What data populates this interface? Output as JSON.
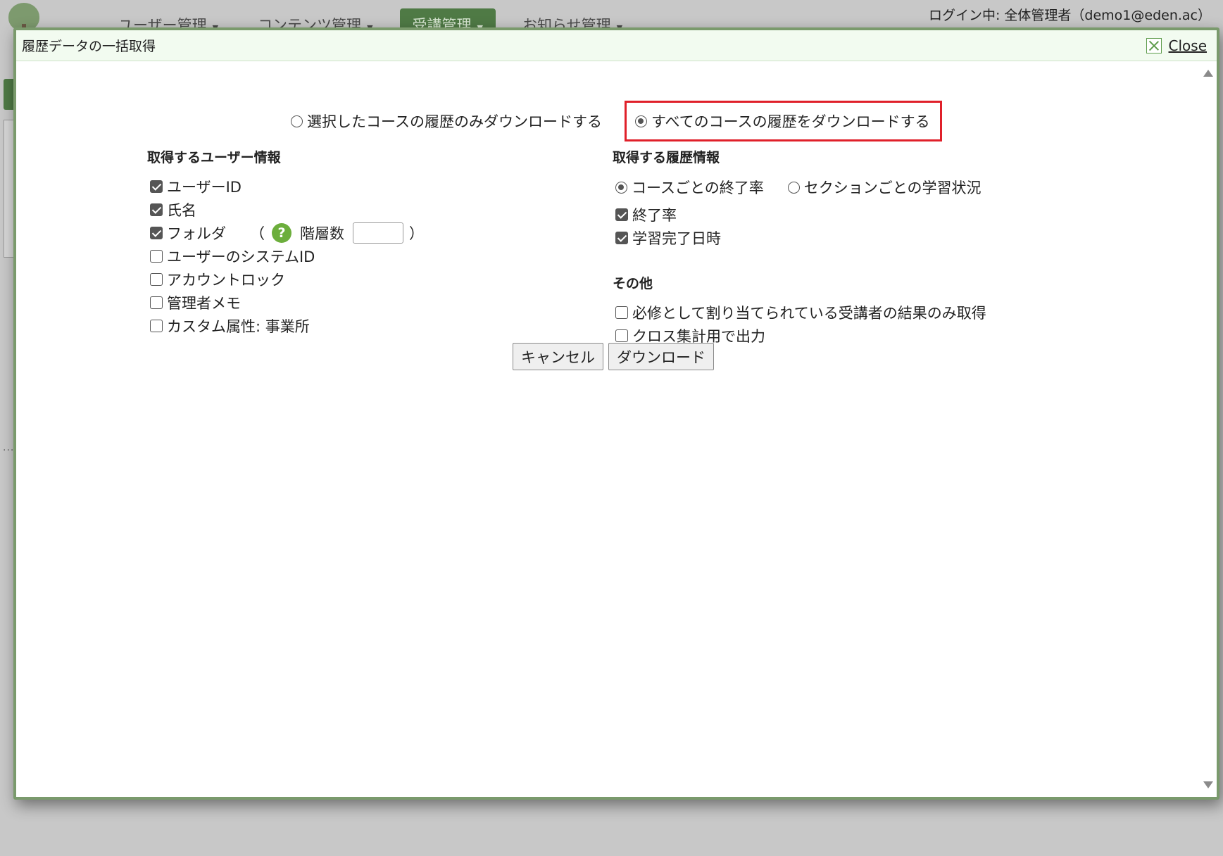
{
  "background": {
    "nav": [
      {
        "label": "ユーザー管理",
        "active": false
      },
      {
        "label": "コンテンツ管理",
        "active": false
      },
      {
        "label": "受講管理",
        "active": true
      },
      {
        "label": "お知らせ管理",
        "active": false
      }
    ],
    "login_status": "ログイン中: 全体管理者（demo1@eden.ac）"
  },
  "modal": {
    "title": "履歴データの一括取得",
    "close_label": "Close",
    "scope_options": [
      {
        "label": "選択したコースの履歴のみダウンロードする",
        "checked": false
      },
      {
        "label": "すべてのコースの履歴をダウンロードする",
        "checked": true
      }
    ],
    "user_info": {
      "heading": "取得するユーザー情報",
      "items": [
        {
          "label": "ユーザーID",
          "checked": true
        },
        {
          "label": "氏名",
          "checked": true
        },
        {
          "label": "フォルダ",
          "checked": true
        },
        {
          "label": "ユーザーのシステムID",
          "checked": false
        },
        {
          "label": "アカウントロック",
          "checked": false
        },
        {
          "label": "管理者メモ",
          "checked": false
        },
        {
          "label": "カスタム属性: 事業所",
          "checked": false
        }
      ],
      "folder_paren_open": "（",
      "folder_paren_close": "）",
      "depth_label": "階層数",
      "depth_value": ""
    },
    "history_info": {
      "heading": "取得する履歴情報",
      "radio_options": [
        {
          "label": "コースごとの終了率",
          "checked": true
        },
        {
          "label": "セクションごとの学習状況",
          "checked": false
        }
      ],
      "items": [
        {
          "label": "終了率",
          "checked": true
        },
        {
          "label": "学習完了日時",
          "checked": true
        }
      ]
    },
    "other": {
      "heading": "その他",
      "items": [
        {
          "label": "必修として割り当てられている受講者の結果のみ取得",
          "checked": false
        },
        {
          "label": "クロス集計用で出力",
          "checked": false
        }
      ]
    },
    "buttons": {
      "cancel": "キャンセル",
      "download": "ダウンロード"
    }
  },
  "colors": {
    "modal_border": "#7a9a6c",
    "header_bg": "#f2fbf0",
    "highlight": "#e0202a",
    "nav_active": "#4f7a45",
    "help_icon": "#6cae3c"
  }
}
